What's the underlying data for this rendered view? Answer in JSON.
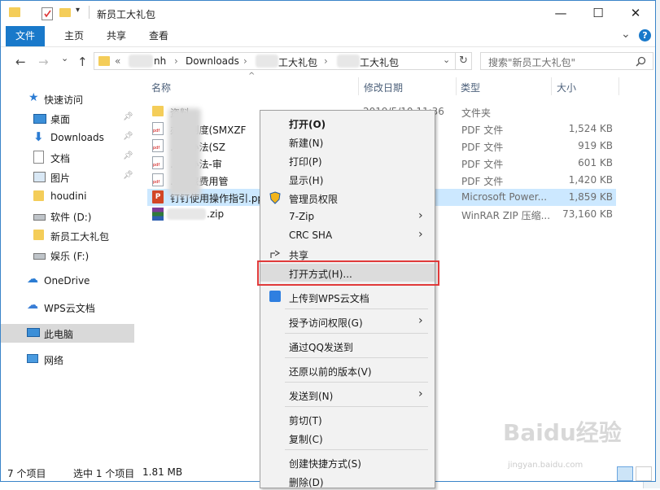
{
  "window": {
    "title": "新员工大礼包",
    "controls": {
      "minimize": "—",
      "maximize": "☐",
      "close": "✕"
    }
  },
  "ribbon": {
    "tabs": [
      "文件",
      "主页",
      "共享",
      "查看"
    ],
    "chevron": "⌄",
    "help": "?"
  },
  "navbar": {
    "back": "←",
    "forward": "→",
    "dropdown": "⌄",
    "up": "↑",
    "crumbs": [
      "«",
      "nh",
      "Downloads",
      "工大礼包",
      "工大礼包"
    ],
    "crumb_sep": "›",
    "search_placeholder": "搜索\"新员工大礼包\"",
    "refresh": "↻"
  },
  "sidebar": {
    "items": [
      {
        "label": "快速访问",
        "icon": "star-icon"
      },
      {
        "label": "桌面",
        "icon": "desktop-icon",
        "pinned": true
      },
      {
        "label": "Downloads",
        "icon": "download-icon",
        "pinned": true
      },
      {
        "label": "文档",
        "icon": "document-icon",
        "pinned": true
      },
      {
        "label": "图片",
        "icon": "picture-icon",
        "pinned": true
      },
      {
        "label": "houdini",
        "icon": "folder-icon"
      },
      {
        "label": "软件 (D:)",
        "icon": "drive-icon"
      },
      {
        "label": "新员工大礼包",
        "icon": "folder-icon"
      },
      {
        "label": "娱乐 (F:)",
        "icon": "drive-icon"
      },
      {
        "label": "OneDrive",
        "icon": "cloud-icon"
      },
      {
        "label": "WPS云文档",
        "icon": "wps-cloud-icon"
      },
      {
        "label": "此电脑",
        "icon": "computer-icon",
        "selected": true
      },
      {
        "label": "网络",
        "icon": "network-icon"
      }
    ]
  },
  "list": {
    "headers": {
      "name": "名称",
      "date": "修改日期",
      "type": "类型",
      "size": "大小"
    },
    "rows": [
      {
        "name": "资料",
        "date": "2019/5/10 11:36",
        "type": "文件夹",
        "size": "",
        "icon": "folder-icon"
      },
      {
        "name": "办...制度(SMXZF",
        "date": "1",
        "type": "PDF 文件",
        "size": "1,524 KB",
        "icon": "pdf-icon"
      },
      {
        "name": "...理办法(SZ",
        "date": "8",
        "type": "PDF 文件",
        "size": "919 KB",
        "icon": "pdf-icon"
      },
      {
        "name": "...理办法-审",
        "date": "8",
        "type": "PDF 文件",
        "size": "601 KB",
        "icon": "pdf-icon"
      },
      {
        "name": "...差旅费用管",
        "date": "8",
        "type": "PDF 文件",
        "size": "1,420 KB",
        "icon": "pdf-icon"
      },
      {
        "name": "钉钉使用操作指引.pp",
        "date": "",
        "type": "Microsoft Power...",
        "size": "1,859 KB",
        "icon": "ppt-icon",
        "selected": true
      },
      {
        "name": ".zip",
        "date": "0",
        "type": "WinRAR ZIP 压缩...",
        "size": "73,160 KB",
        "icon": "zip-icon"
      }
    ]
  },
  "status": {
    "count": "7 个项目",
    "selected": "选中 1 个项目",
    "size": "1.81 MB"
  },
  "context_menu": {
    "items": [
      {
        "label": "打开(O)",
        "bold": true
      },
      {
        "label": "新建(N)"
      },
      {
        "label": "打印(P)"
      },
      {
        "label": "显示(H)"
      },
      {
        "label": "管理员权限",
        "icon": "shield-icon"
      },
      {
        "label": "7-Zip",
        "submenu": true
      },
      {
        "label": "CRC SHA",
        "submenu": true
      },
      {
        "label": "共享",
        "icon": "share-icon"
      },
      {
        "label": "打开方式(H)...",
        "highlighted": true
      },
      {
        "label": "上传到WPS云文档",
        "icon": "wps-upload-icon"
      },
      {
        "label": "授予访问权限(G)",
        "submenu": true
      },
      {
        "label": "通过QQ发送到"
      },
      {
        "label": "还原以前的版本(V)"
      },
      {
        "label": "发送到(N)",
        "submenu": true
      },
      {
        "label": "剪切(T)"
      },
      {
        "label": "复制(C)"
      },
      {
        "label": "创建快捷方式(S)"
      },
      {
        "label": "删除(D)"
      }
    ],
    "submenu_arrow": "›"
  },
  "watermark": {
    "text": "Baidu经验",
    "url": "jingyan.baidu.com"
  },
  "colors": {
    "accent": "#1979ca",
    "selection": "#cce8ff",
    "highlight": "#e03a3a"
  }
}
